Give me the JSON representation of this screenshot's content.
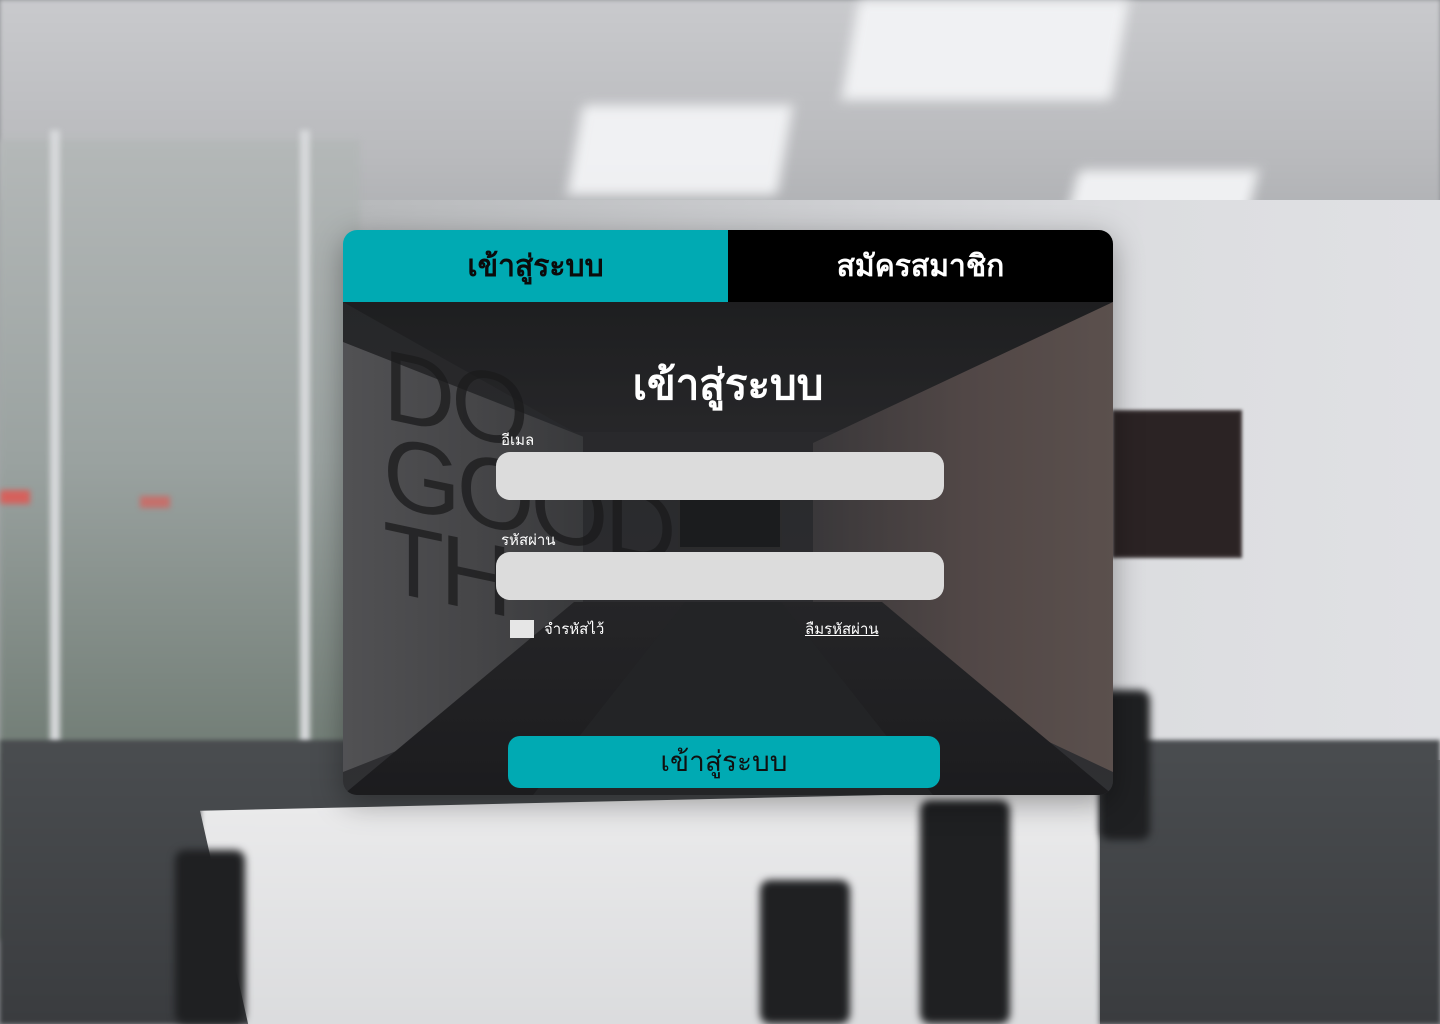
{
  "colors": {
    "accent": "#00aab3",
    "tab_inactive_bg": "#000000",
    "input_bg": "#dcdcdc"
  },
  "background": {
    "wall_text": [
      "DO",
      "GOOD",
      "TH"
    ]
  },
  "tabs": [
    {
      "label": "เข้าสู่ระบบ",
      "active": true
    },
    {
      "label": "สมัครสมาชิก",
      "active": false
    }
  ],
  "form": {
    "title": "เข้าสู่ระบบ",
    "email": {
      "label": "อีเมล",
      "value": ""
    },
    "password": {
      "label": "รหัสผ่าน",
      "value": ""
    },
    "remember": {
      "label": "จำรหัสไว้",
      "checked": false
    },
    "forgot_link": "ลืมรหัสผ่าน",
    "submit_label": "เข้าสู่ระบบ"
  }
}
